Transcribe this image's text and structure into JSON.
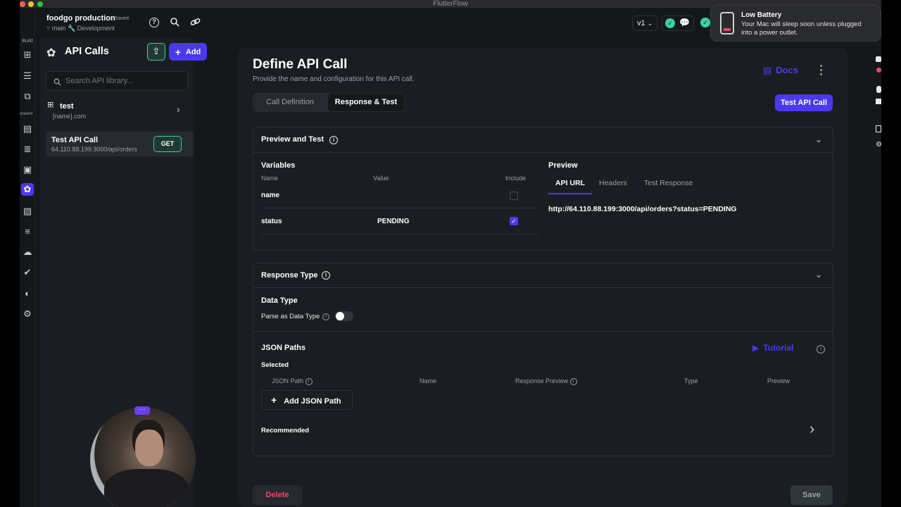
{
  "window": {
    "title": "FlutterFlow"
  },
  "project": {
    "name": "foodgo production",
    "status": "Saved",
    "branch": "main",
    "env": "Development"
  },
  "topbar": {
    "version": "v1"
  },
  "notification": {
    "title": "Low Battery",
    "body_line1": "Your Mac will sleep soon unless plugged",
    "body_line2": "into a power outlet."
  },
  "rail": {
    "build_label": "Build",
    "cursor_label": "oneent"
  },
  "left_panel": {
    "title": "API Calls",
    "add_label": "Add",
    "search_placeholder": "Search API library...",
    "items": [
      {
        "name": "test",
        "subtitle": "[name].com"
      },
      {
        "name": "Test API Call",
        "subtitle": "64.110.88.199:3000/api/orders",
        "method": "GET"
      }
    ]
  },
  "main": {
    "title": "Define API Call",
    "subtitle": "Provide the name and configuration for this API call.",
    "docs_label": "Docs",
    "tabs": [
      {
        "label": "Call Definition"
      },
      {
        "label": "Response & Test"
      }
    ],
    "test_button": "Test API Call",
    "preview_test": {
      "title": "Preview and Test",
      "variables_title": "Variables",
      "col_name": "Name",
      "col_value": "Value",
      "col_include": "Include",
      "rows": [
        {
          "name": "name",
          "value": "",
          "include": false
        },
        {
          "name": "status",
          "value": "PENDING",
          "include": true
        }
      ],
      "preview_title": "Preview",
      "preview_tabs": [
        {
          "label": "API URL"
        },
        {
          "label": "Headers"
        },
        {
          "label": "Test Response"
        }
      ],
      "url": "http://64.110.88.199:3000/api/orders?status=PENDING"
    },
    "response_type": {
      "title": "Response Type",
      "data_type_title": "Data Type",
      "parse_label": "Parse as Data Type",
      "json_paths_title": "JSON Paths",
      "tutorial_label": "Tutorial",
      "selected_label": "Selected",
      "columns": {
        "json_path": "JSON Path",
        "name": "Name",
        "response_preview": "Response Preview",
        "type": "Type",
        "preview": "Preview"
      },
      "add_json_path": "Add JSON Path",
      "recommended_label": "Recommended"
    },
    "delete_label": "Delete",
    "save_label": "Save"
  },
  "colors": {
    "accent": "#4b39ef",
    "success": "#39d2a0",
    "danger": "#e84a5f"
  }
}
